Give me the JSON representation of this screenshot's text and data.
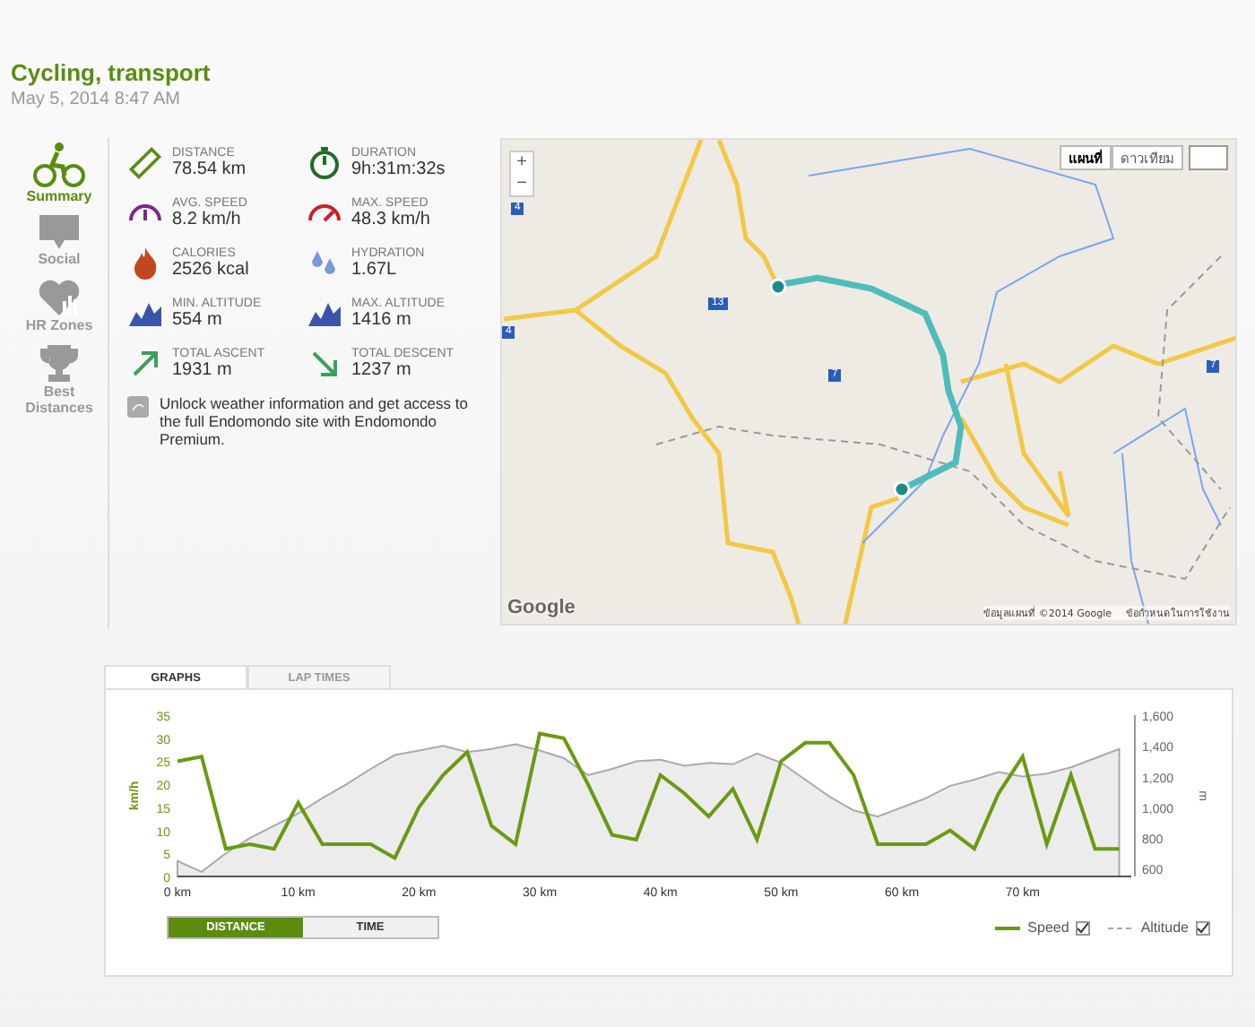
{
  "header": {
    "title": "Cycling, transport",
    "date": "May 5, 2014 8:47 AM"
  },
  "sidebar": {
    "items": [
      {
        "kind": "bike",
        "label": "Summary",
        "selected": true
      },
      {
        "kind": "chat",
        "label": "Social",
        "selected": false
      },
      {
        "kind": "heart",
        "label": "HR Zones",
        "selected": false
      },
      {
        "kind": "trophy",
        "label": "Best Distances",
        "selected": false
      }
    ]
  },
  "stats": [
    {
      "kind": "distance",
      "label": "DISTANCE",
      "value": "78.54 km"
    },
    {
      "kind": "duration",
      "label": "DURATION",
      "value": "9h:31m:32s"
    },
    {
      "kind": "avgspeed",
      "label": "AVG. SPEED",
      "value": "8.2 km/h"
    },
    {
      "kind": "maxspeed",
      "label": "MAX. SPEED",
      "value": "48.3 km/h"
    },
    {
      "kind": "calories",
      "label": "CALORIES",
      "value": "2526 kcal"
    },
    {
      "kind": "hydration",
      "label": "HYDRATION",
      "value": "1.67L"
    },
    {
      "kind": "altitude",
      "label": "MIN. ALTITUDE",
      "value": "554 m"
    },
    {
      "kind": "altitude",
      "label": "MAX. ALTITUDE",
      "value": "1416 m"
    },
    {
      "kind": "ascent",
      "label": "TOTAL ASCENT",
      "value": "1931 m"
    },
    {
      "kind": "descent",
      "label": "TOTAL DESCENT",
      "value": "1237 m"
    }
  ],
  "premium_note": "Unlock weather information and get access to the full Endomondo site with Endomondo Premium.",
  "map": {
    "zoom_in": "+",
    "zoom_out": "−",
    "types": [
      {
        "label": "แผนที่",
        "selected": true
      },
      {
        "label": "ดาวเทียม",
        "selected": false
      }
    ],
    "logo": "Google",
    "attribution": "ข้อมูลแผนที่ ©2014 Google",
    "terms": "ข้อกำหนดในการใช้งาน",
    "shields": [
      "4",
      "4",
      "13",
      "7",
      "7"
    ]
  },
  "graph_panel": {
    "tabs": [
      {
        "label": "GRAPHS",
        "selected": true
      },
      {
        "label": "LAP TIMES",
        "selected": false
      }
    ],
    "speed_graph": {
      "chart_data": {
        "type": "line",
        "ylabel": "km/h",
        "x": [
          0,
          2,
          4,
          6,
          8,
          10,
          12,
          14,
          16,
          18,
          20,
          22,
          24,
          26,
          28,
          30,
          32,
          34,
          36,
          38,
          40,
          42,
          44,
          46,
          48,
          50,
          52,
          54,
          56,
          58,
          60,
          62,
          64,
          66,
          68,
          70,
          72,
          74,
          76,
          78
        ],
        "series": [
          {
            "name": "Speed",
            "color": "#6a9a12",
            "values": [
              25,
              26,
              6,
              7,
              6,
              16,
              7,
              7,
              7,
              4,
              15,
              22,
              27,
              11,
              7,
              31,
              30,
              20,
              9,
              8,
              22,
              18,
              13,
              19,
              8,
              25,
              29,
              29,
              22,
              7,
              7,
              7,
              10,
              6,
              18,
              26,
              7,
              22,
              6,
              6
            ]
          }
        ],
        "xlim": [
          0,
          79
        ],
        "ylim": [
          0,
          35
        ],
        "xticks": [
          {
            "value": 0,
            "label": "0 km"
          },
          {
            "value": 10,
            "label": "10 km"
          },
          {
            "value": 20,
            "label": "20 km"
          },
          {
            "value": 30,
            "label": "30 km"
          },
          {
            "value": 40,
            "label": "40 km"
          },
          {
            "value": 50,
            "label": "50 km"
          },
          {
            "value": 60,
            "label": "60 km"
          },
          {
            "value": 70,
            "label": "70 km"
          }
        ],
        "yticks": [
          0,
          5,
          10,
          15,
          20,
          25,
          30,
          35
        ]
      }
    },
    "altitude_graph": {
      "chart_data": {
        "type": "area",
        "ylabel": "m",
        "x": [
          0,
          2,
          4,
          6,
          8,
          10,
          12,
          14,
          16,
          18,
          20,
          22,
          24,
          26,
          28,
          30,
          32,
          34,
          36,
          38,
          40,
          42,
          44,
          46,
          48,
          50,
          52,
          54,
          56,
          58,
          60,
          62,
          64,
          66,
          68,
          70,
          72,
          74,
          76,
          78
        ],
        "series": [
          {
            "name": "Altitude",
            "color": "#aaaaaa",
            "values": [
              650,
              580,
              700,
              800,
              880,
              960,
              1060,
              1150,
              1250,
              1340,
              1370,
              1400,
              1360,
              1380,
              1410,
              1370,
              1320,
              1210,
              1250,
              1300,
              1310,
              1270,
              1290,
              1280,
              1350,
              1290,
              1180,
              1070,
              980,
              940,
              1000,
              1060,
              1140,
              1180,
              1230,
              1200,
              1220,
              1260,
              1320,
              1380
            ]
          }
        ],
        "xlim": [
          0,
          79
        ],
        "ylim": [
          550,
          1600
        ],
        "yticks": [
          {
            "value": 600,
            "label": "600"
          },
          {
            "value": 800,
            "label": "800"
          },
          {
            "value": 1000,
            "label": "1,000"
          },
          {
            "value": 1200,
            "label": "1,200"
          },
          {
            "value": 1400,
            "label": "1,400"
          },
          {
            "value": 1600,
            "label": "1,600"
          }
        ]
      }
    },
    "modes": [
      {
        "label": "DISTANCE",
        "selected": true
      },
      {
        "label": "TIME",
        "selected": false
      }
    ],
    "legend": [
      {
        "kind": "solid",
        "checked": true
      },
      {
        "kind": "dashed",
        "checked": true
      }
    ]
  }
}
